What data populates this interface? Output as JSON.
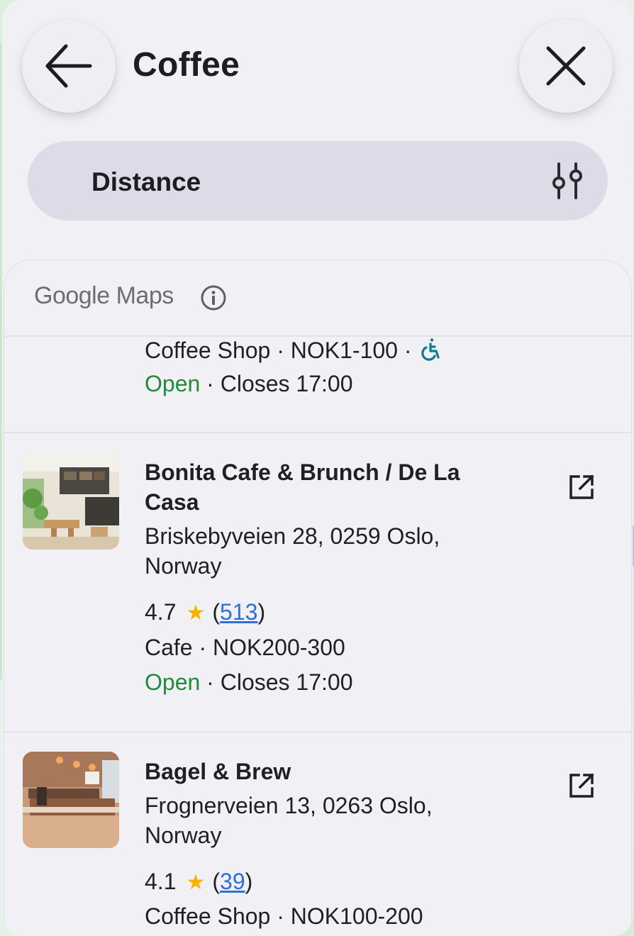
{
  "header": {
    "title": "Coffee",
    "back_icon": "back-arrow-icon",
    "close_icon": "close-icon"
  },
  "sort": {
    "label": "Distance",
    "icon": "filter-sliders-icon"
  },
  "attribution": {
    "logo_word1": "Google",
    "logo_word2": "Maps",
    "icon": "info-icon"
  },
  "partial_item": {
    "category": "Coffee Shop",
    "price": "NOK1-100",
    "accessibility_icon": "wheelchair-icon",
    "status": "Open",
    "hours": "Closes 17:00",
    "separator": " · "
  },
  "results": [
    {
      "name": "Bonita Cafe & Brunch / De La Casa",
      "address": "Briskebyveien 28, 0259 Oslo, Norway",
      "rating": "4.7",
      "reviews": "513",
      "category": "Cafe",
      "price": "NOK200-300",
      "status": "Open",
      "hours": "Closes 17:00"
    },
    {
      "name": "Bagel & Brew",
      "address": "Frognerveien 13, 0263 Oslo, Norway",
      "rating": "4.1",
      "reviews": "39",
      "category": "Coffee Shop",
      "price": "NOK100-200"
    }
  ],
  "colors": {
    "open": "#1e8c3a",
    "star": "#f6b400",
    "link": "#2f6fd6",
    "sort_bar": "#dbdce8",
    "panel": "#f0f0f5"
  }
}
